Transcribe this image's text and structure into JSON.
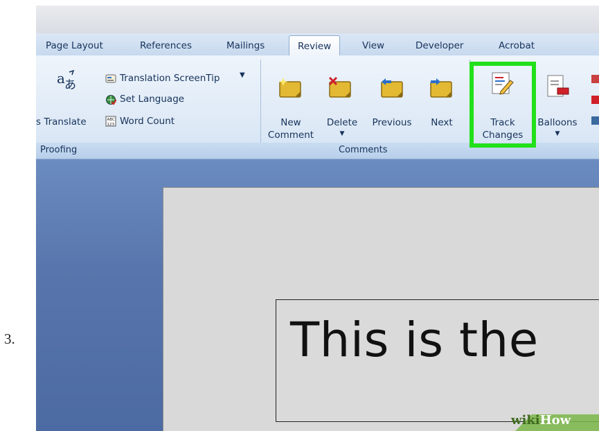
{
  "step_number": "3.",
  "tabs": [
    "Page Layout",
    "References",
    "Mailings",
    "Review",
    "View",
    "Developer",
    "Acrobat"
  ],
  "active_tab": "Review",
  "proofing": {
    "translate_label": "s Translate",
    "translation_screentip": "Translation ScreenTip",
    "set_language": "Set Language",
    "word_count": "Word Count",
    "group_label": "Proofing"
  },
  "comments": {
    "new_line1": "New",
    "new_line2": "Comment",
    "delete": "Delete",
    "previous": "Previous",
    "next": "Next",
    "group_label": "Comments"
  },
  "tracking": {
    "track_line1": "Track",
    "track_line2": "Changes",
    "balloons": "Balloons"
  },
  "document": {
    "text": "This is the"
  },
  "watermark": {
    "wiki": "wiki",
    "how": "How"
  },
  "colors": {
    "highlight": "#22e01a",
    "ribbon_text": "#15325a",
    "doc_background": "#5876ad"
  }
}
